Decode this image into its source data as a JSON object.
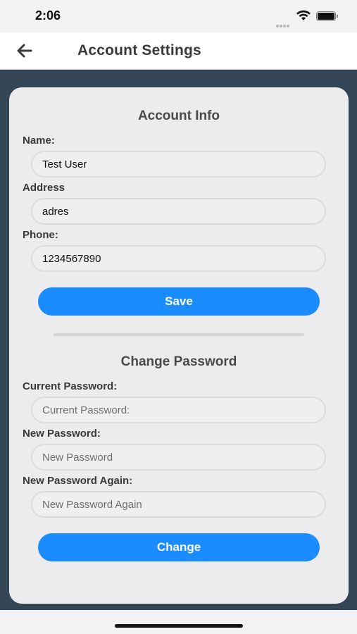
{
  "status_bar": {
    "time": "2:06",
    "icons": [
      "cellular-dots-icon",
      "wifi-icon",
      "battery-icon"
    ]
  },
  "header": {
    "back_icon": "arrow-left-icon",
    "title": "Account Settings"
  },
  "account_info": {
    "title": "Account Info",
    "name_label": "Name:",
    "name_value": "Test User",
    "address_label": "Address",
    "address_value": "adres",
    "phone_label": "Phone:",
    "phone_value": "1234567890",
    "save_label": "Save"
  },
  "change_password": {
    "title": "Change Password",
    "current_label": "Current Password:",
    "current_placeholder": "Current Password:",
    "new_label": "New Password:",
    "new_placeholder": "New Password",
    "again_label": "New Password Again:",
    "again_placeholder": "New Password Again",
    "change_label": "Change"
  },
  "colors": {
    "accent": "#1a8cff",
    "background_dark": "#344556",
    "card": "#ececee"
  }
}
